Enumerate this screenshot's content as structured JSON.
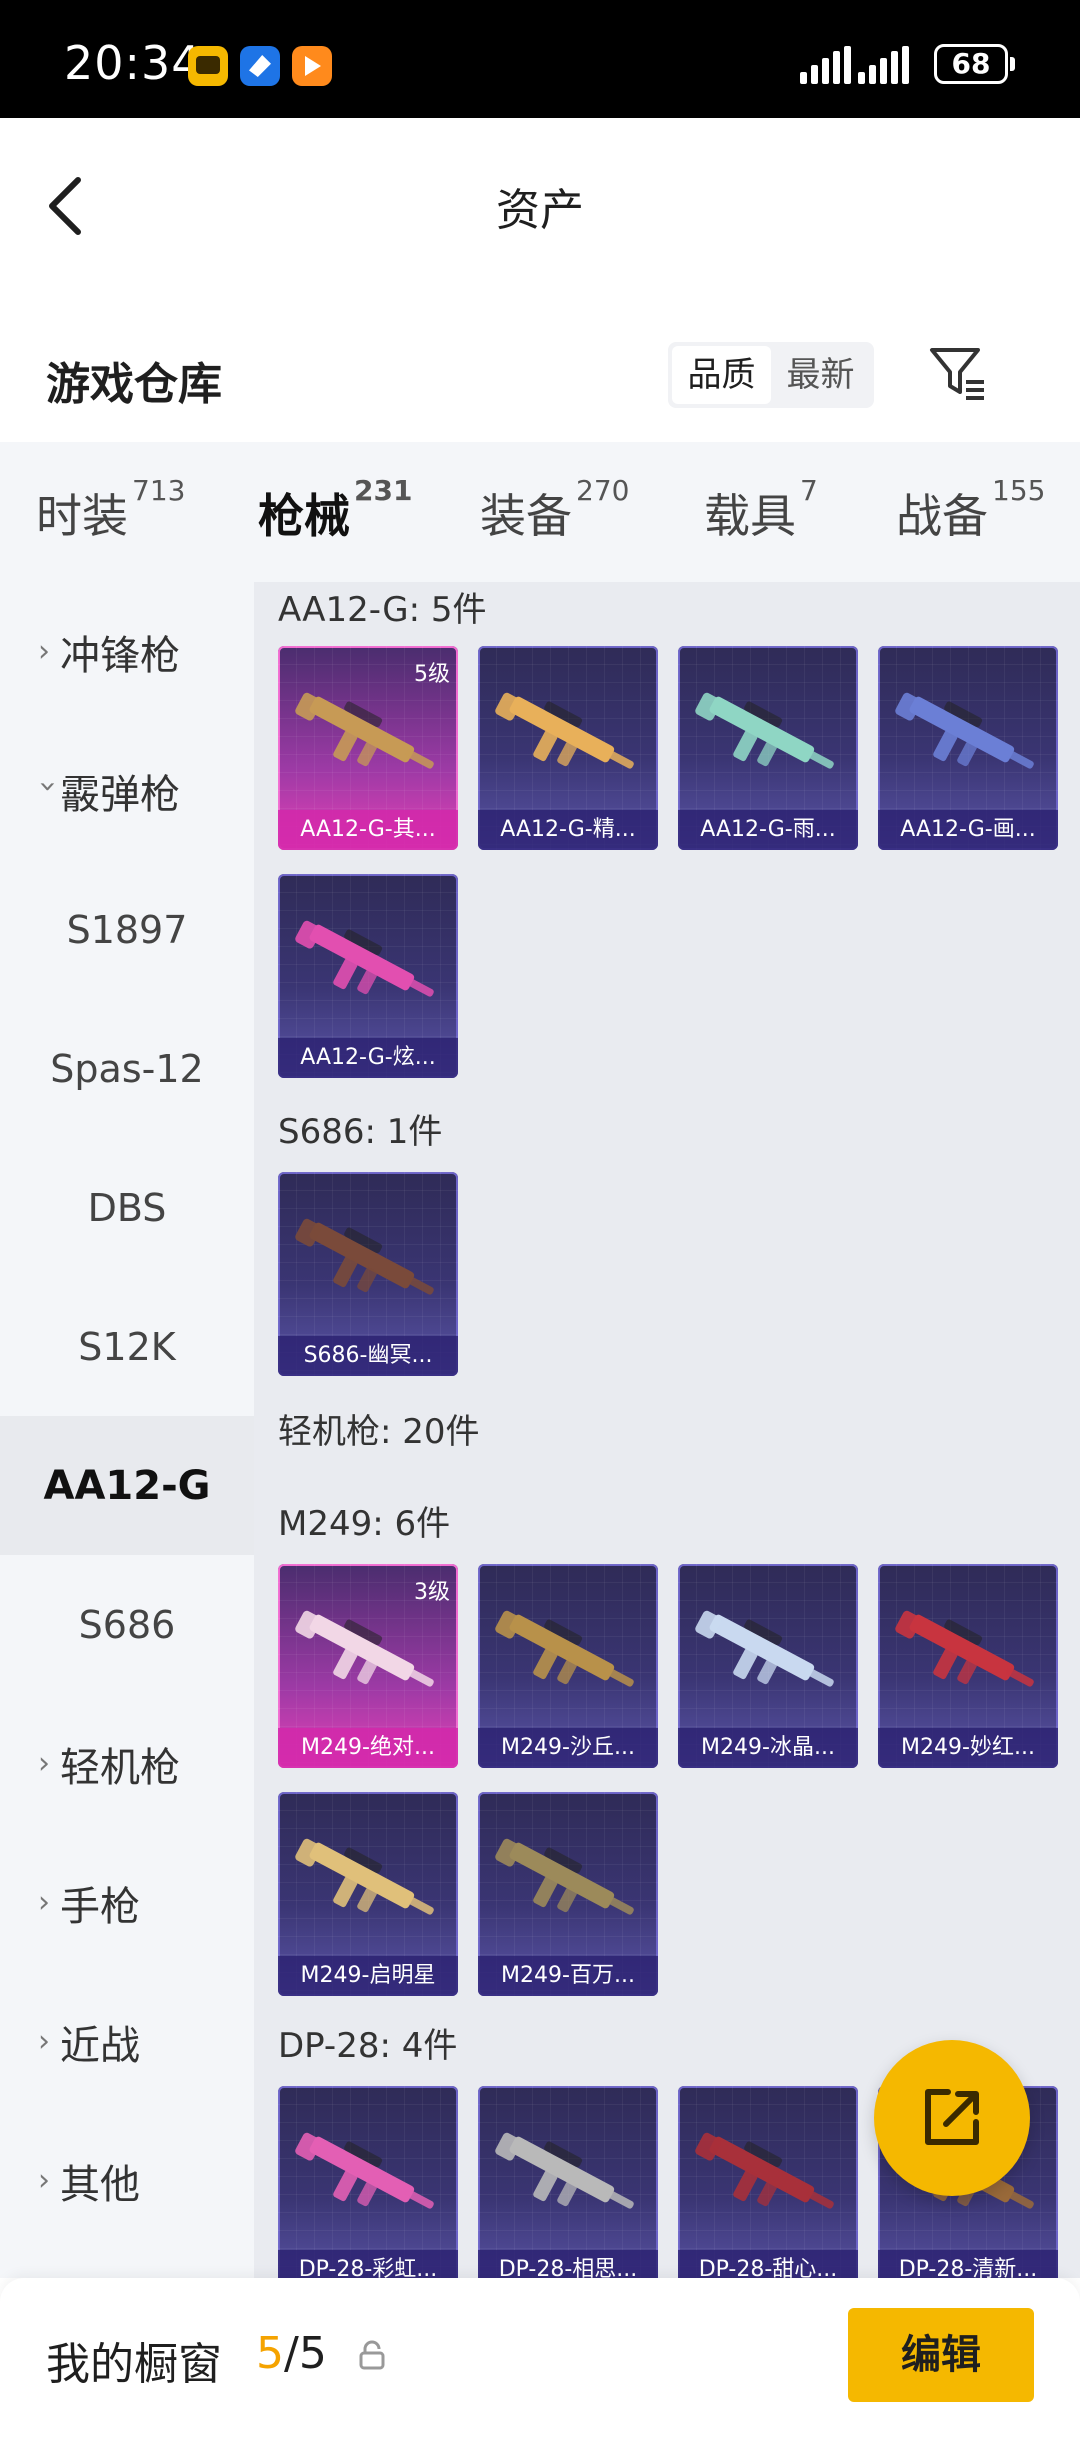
{
  "status_bar": {
    "time": "20:34",
    "battery": "68"
  },
  "header": {
    "title": "资产"
  },
  "section": {
    "title": "游戏仓库",
    "sort_options": [
      "品质",
      "最新"
    ],
    "sort_active": 0
  },
  "tabs": [
    {
      "label": "时装",
      "count": "713"
    },
    {
      "label": "枪械",
      "count": "231"
    },
    {
      "label": "装备",
      "count": "270"
    },
    {
      "label": "载具",
      "count": "7"
    },
    {
      "label": "战备",
      "count": "155"
    }
  ],
  "side_nav": [
    {
      "label": "冲锋枪"
    },
    {
      "label": "霰弹枪"
    },
    {
      "label": "S1897"
    },
    {
      "label": "Spas-12"
    },
    {
      "label": "DBS"
    },
    {
      "label": "S12K"
    },
    {
      "label": "AA12-G"
    },
    {
      "label": "S686"
    },
    {
      "label": "轻机枪"
    },
    {
      "label": "手枪"
    },
    {
      "label": "近战"
    },
    {
      "label": "其他"
    }
  ],
  "groups": {
    "aa12": "AA12-G: 5件",
    "s686": "S686: 1件",
    "lmg": "轻机枪: 20件",
    "m249": "M249: 6件",
    "dp28": "DP-28: 4件"
  },
  "cards": {
    "aa12": [
      {
        "label": "AA12-G-其...",
        "level": "5级",
        "tier": "legend",
        "color": "#c79a55"
      },
      {
        "label": "AA12-G-精...",
        "tier": "epic",
        "color": "#e8b05a"
      },
      {
        "label": "AA12-G-雨...",
        "tier": "epic",
        "color": "#8fd6c4"
      },
      {
        "label": "AA12-G-画...",
        "tier": "epic",
        "color": "#6b7fd6"
      },
      {
        "label": "AA12-G-炫...",
        "tier": "epic",
        "color": "#e24fb0"
      }
    ],
    "s686": [
      {
        "label": "S686-幽冥...",
        "tier": "epic",
        "color": "#7a4a3a"
      }
    ],
    "m249": [
      {
        "label": "M249-绝对...",
        "level": "3级",
        "tier": "legend",
        "color": "#f2d7e6"
      },
      {
        "label": "M249-沙丘...",
        "tier": "epic",
        "color": "#b8914a"
      },
      {
        "label": "M249-冰晶...",
        "tier": "epic",
        "color": "#c9d9f0"
      },
      {
        "label": "M249-妙红...",
        "tier": "epic",
        "color": "#c8343f"
      },
      {
        "label": "M249-启明星",
        "tier": "epic",
        "color": "#e0c07a"
      },
      {
        "label": "M249-百万...",
        "tier": "epic",
        "color": "#9c8a5a"
      }
    ],
    "dp28": [
      {
        "label": "DP-28-彩虹...",
        "tier": "epic",
        "color": "#e35fb4"
      },
      {
        "label": "DP-28-相思...",
        "tier": "epic",
        "color": "#b9b9b9"
      },
      {
        "label": "DP-28-甜心...",
        "tier": "epic",
        "color": "#a8303a"
      },
      {
        "label": "DP-28-清新...",
        "tier": "epic",
        "color": "#9a6a3a"
      }
    ]
  },
  "bottom_bar": {
    "label": "我的橱窗",
    "current": "5",
    "total": "/5",
    "edit_label": "编辑"
  }
}
